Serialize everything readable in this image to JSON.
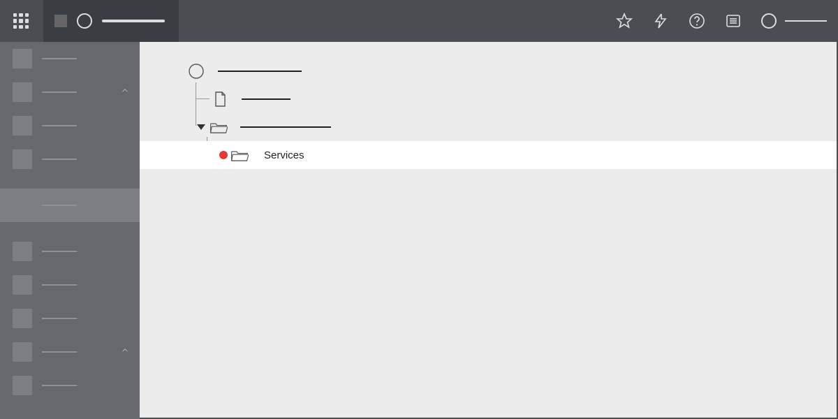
{
  "header": {
    "apps_icon": "apps-grid",
    "tab": {
      "title_placeholder": "",
      "icon": "square"
    },
    "actions": {
      "star": "star-icon",
      "lightning": "lightning-icon",
      "help": "help-icon",
      "list": "list-panel-icon"
    },
    "user": {
      "name_placeholder": ""
    }
  },
  "sidebar": {
    "items": [
      {
        "label": "",
        "has_chevron": false
      },
      {
        "label": "",
        "has_chevron": true
      },
      {
        "label": "",
        "has_chevron": false
      },
      {
        "label": "",
        "has_chevron": false
      },
      {
        "label": "",
        "has_chevron": false,
        "selected": true
      },
      {
        "label": "",
        "has_chevron": false
      },
      {
        "label": "",
        "has_chevron": false
      },
      {
        "label": "",
        "has_chevron": false
      },
      {
        "label": "",
        "has_chevron": true
      },
      {
        "label": "",
        "has_chevron": false
      }
    ]
  },
  "tree": {
    "root": {
      "icon": "circle",
      "label": ""
    },
    "nodes": [
      {
        "icon": "document",
        "label": ""
      },
      {
        "icon": "folder-open",
        "expanded": true,
        "label": ""
      }
    ],
    "selected": {
      "icon": "folder-open",
      "label": "Services",
      "badge": "red-dot"
    }
  },
  "colors": {
    "header_bg": "#4a4d52",
    "sidebar_bg": "#66686c",
    "main_bg": "#ececec",
    "select_bg": "#ffffff",
    "badge": "#e53935"
  }
}
